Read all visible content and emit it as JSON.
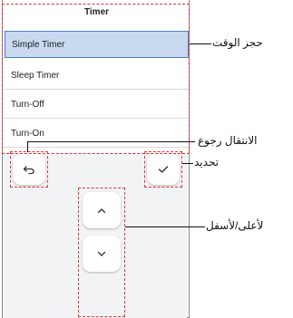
{
  "menu": {
    "title": "Timer",
    "items": [
      {
        "label": "Simple Timer",
        "selected": true
      },
      {
        "label": "Sleep Timer",
        "selected": false
      },
      {
        "label": "Turn-Off",
        "selected": false
      },
      {
        "label": "Turn-On",
        "selected": false
      }
    ]
  },
  "callouts": {
    "timer_booking": "حجز الوقت",
    "back": "الانتقال رجوع",
    "select": "تحديد",
    "up_down": "لأعلى/لأسفل"
  },
  "colors": {
    "highlight_border": "#e0323a",
    "selected_bg": "#c8d9f0",
    "selected_border": "#4a80c8",
    "pad_bg": "#f2f3f5"
  },
  "icons": [
    "back-arrow-icon",
    "checkmark-icon",
    "chevron-up-icon",
    "chevron-down-icon"
  ]
}
